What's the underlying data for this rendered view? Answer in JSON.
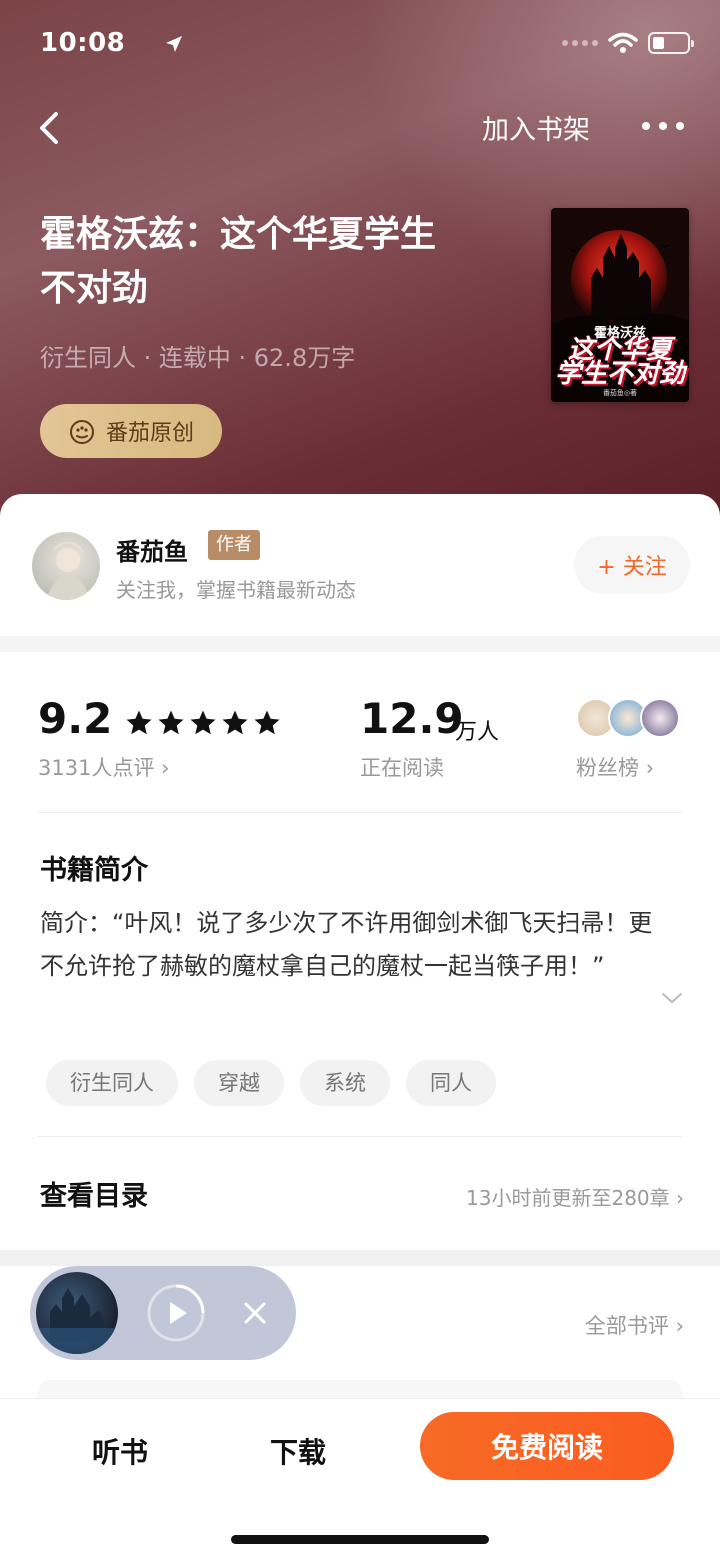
{
  "status_bar": {
    "time": "10:08"
  },
  "nav": {
    "add_to_shelf": "加入书架"
  },
  "book": {
    "title": "霍格沃兹：这个华夏学生不对劲",
    "meta": "衍生同人 · 连载中 · 62.8万字",
    "badge": "番茄原创",
    "cover": {
      "small_title": "霍格沃兹",
      "big_title_line1": "这个华夏",
      "big_title_line2": "学生不对劲",
      "author": "番茄鱼◎著"
    }
  },
  "author": {
    "name": "番茄鱼",
    "tag": "作者",
    "subtitle": "关注我，掌握书籍最新动态",
    "follow_label": "+ 关注"
  },
  "stats": {
    "score": "9.2",
    "rating_stars": 5,
    "reviews": "3131人点评",
    "readers": "12.9",
    "readers_unit": "万人",
    "readers_label": "正在阅读",
    "fans_label": "粉丝榜"
  },
  "intro": {
    "heading": "书籍简介",
    "text": "简介：“叶风！说了多少次了不许用御剑术御飞天扫帚！更不允许抢了赫敏的魔杖拿自己的魔杖一起当筷子用！”"
  },
  "tags": [
    "衍生同人",
    "穿越",
    "系统",
    "同人"
  ],
  "toc": {
    "label": "查看目录",
    "update_info": "13小时前更新至280章"
  },
  "reviews_section": {
    "all_reviews": "全部书评"
  },
  "bottom_bar": {
    "listen": "听书",
    "download": "下载",
    "read": "免费阅读"
  },
  "colors": {
    "accent": "#f86a26",
    "badge_gold": "#e3c696",
    "hero_bg": "#7a4447",
    "author_tag": "#b88c67"
  }
}
